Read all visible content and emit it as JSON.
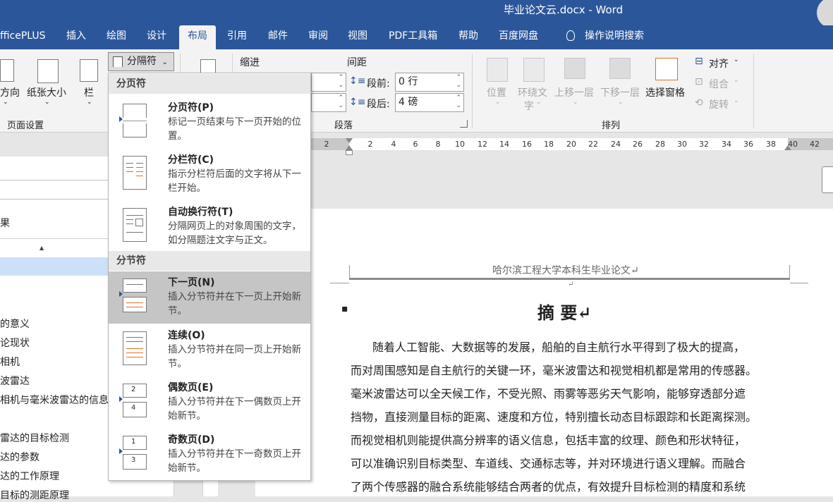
{
  "window": {
    "title": "毕业论文云.docx  -  Word"
  },
  "tabs": [
    {
      "label": "fficePLUS"
    },
    {
      "label": "插入"
    },
    {
      "label": "绘图"
    },
    {
      "label": "设计"
    },
    {
      "label": "布局"
    },
    {
      "label": "引用"
    },
    {
      "label": "邮件"
    },
    {
      "label": "审阅"
    },
    {
      "label": "视图"
    },
    {
      "label": "PDF工具箱"
    },
    {
      "label": "帮助"
    },
    {
      "label": "百度网盘"
    },
    {
      "label": "操作说明搜索"
    }
  ],
  "ribbon": {
    "orientation": "方向",
    "size": "纸张大小",
    "columns": "栏",
    "page_setup_group": "页面设置",
    "breaks_button": "分隔符",
    "indent_label": "缩进",
    "spacing_label": "间距",
    "before_label": "段前:",
    "before_value": "0 行",
    "after_label": "段后:",
    "after_value": "4 磅",
    "paragraph_group": "段落",
    "position": "位置",
    "wrap_text_1": "环绕文",
    "wrap_text_2": "字",
    "bring_forward": "上移一层",
    "send_backward": "下移一层",
    "selection_pane": "选择窗格",
    "align": "对齐",
    "group": "组合",
    "rotate": "旋转",
    "arrange_group": "排列"
  },
  "ruler": {
    "ticks": [
      "2",
      "2",
      "4",
      "6",
      "8",
      "10",
      "12",
      "14",
      "16",
      "18",
      "20",
      "22",
      "24",
      "26",
      "28",
      "30",
      "32",
      "34",
      "36",
      "38",
      "40",
      "42"
    ]
  },
  "navigation": {
    "items": [
      {
        "label": "果"
      },
      {
        "label": "的意义"
      },
      {
        "label": "论现状"
      },
      {
        "label": "相机"
      },
      {
        "label": "波雷达"
      },
      {
        "label": "相机与毫米波雷达的信息"
      },
      {
        "label": "雷达的目标检测"
      },
      {
        "label": "达的参数"
      },
      {
        "label": "达的工作原理"
      },
      {
        "label": "目标的测距原理"
      }
    ]
  },
  "breaks_menu": {
    "page_breaks_header": "分页符",
    "section_breaks_header": "分节符",
    "items": [
      {
        "title": "分页符(P)",
        "desc": "标记一页结束与下一页开始的位置。"
      },
      {
        "title": "分栏符(C)",
        "desc": "指示分栏符后面的文字将从下一栏开始。"
      },
      {
        "title": "自动换行符(T)",
        "desc": "分隔网页上的对象周围的文字，如分隔题注文字与正文。"
      },
      {
        "title": "下一页(N)",
        "desc": "插入分节符并在下一页上开始新节。"
      },
      {
        "title": "连续(O)",
        "desc": "插入分节符并在同一页上开始新节。"
      },
      {
        "title": "偶数页(E)",
        "desc": "插入分节符并在下一偶数页上开始新节。"
      },
      {
        "title": "奇数页(D)",
        "desc": "插入分节符并在下一奇数页上开始新节。"
      }
    ]
  },
  "document": {
    "header": "哈尔滨工程大学本科生毕业论文↵",
    "header_mark": "↵",
    "heading": "摘    要↵",
    "lines": [
      "随着人工智能、大数据等的发展，船舶的自主航行水平得到了极大的提高，",
      "而对周围感知是自主航行的关键一环，毫米波雷达和视觉相机都是常用的传感器。",
      "毫米波雷达可以全天候工作，不受光照、雨雾等恶劣天气影响，能够穿透部分遮",
      "挡物，直接测量目标的距离、速度和方位，特别擅长动态目标跟踪和长距离探测。",
      "而视觉相机则能提供高分辨率的语义信息，包括丰富的纹理、颜色和形状特征，",
      "可以准确识别目标类型、车道线、交通标志等，并对环境进行语义理解。而融合",
      "了两个传感器的融合系统能够结合两者的优点，有效提升目标检测的精度和系统"
    ]
  }
}
